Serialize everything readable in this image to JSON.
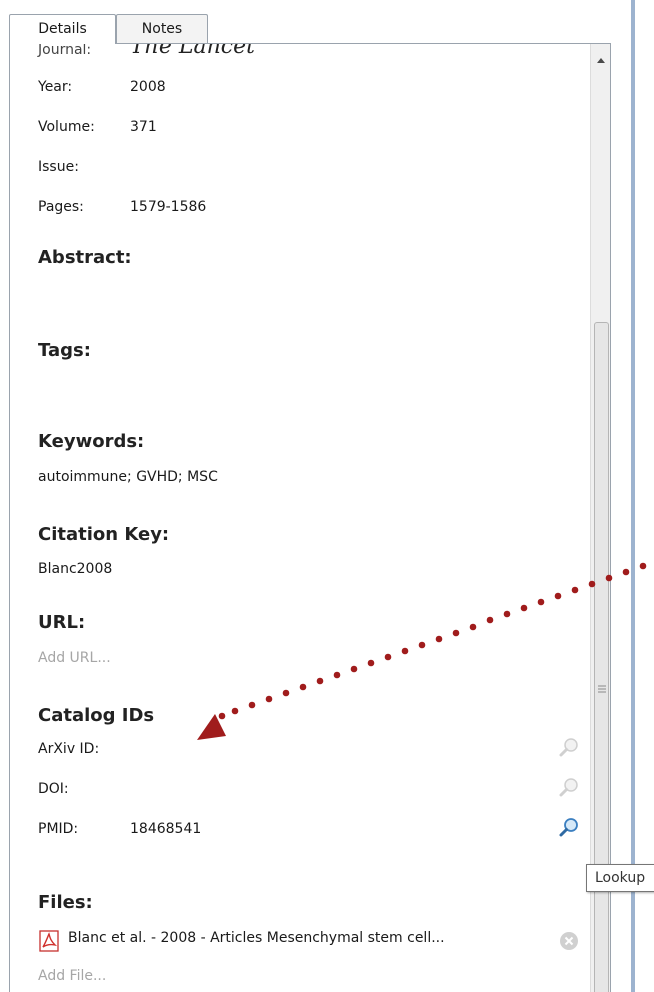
{
  "tabs": [
    {
      "label": "Details",
      "active": true
    },
    {
      "label": "Notes",
      "active": false
    }
  ],
  "fields": {
    "journal_label": "Journal:",
    "journal_value": "The Lancet",
    "year_label": "Year:",
    "year_value": "2008",
    "volume_label": "Volume:",
    "volume_value": "371",
    "issue_label": "Issue:",
    "issue_value": "",
    "pages_label": "Pages:",
    "pages_value": "1579-1586"
  },
  "sections": {
    "abstract": "Abstract:",
    "tags": "Tags:",
    "keywords": "Keywords:",
    "keywords_value": "autoimmune; GVHD; MSC",
    "citation_key": "Citation Key:",
    "citation_key_value": "Blanc2008",
    "url": "URL:",
    "url_placeholder": "Add URL...",
    "catalog_ids": "Catalog IDs",
    "files": "Files:",
    "add_file": "Add File..."
  },
  "catalog": [
    {
      "label": "ArXiv ID:",
      "value": "",
      "icon": "magnifier-icon",
      "active": false
    },
    {
      "label": "DOI:",
      "value": "",
      "icon": "magnifier-icon",
      "active": false
    },
    {
      "label": "PMID:",
      "value": "18468541",
      "icon": "magnifier-icon",
      "active": true
    }
  ],
  "files": [
    {
      "name": "Blanc et al. - 2008 - Articles Mesenchymal stem cell...",
      "icon": "pdf-icon"
    }
  ],
  "tooltip": "Lookup",
  "colors": {
    "arrow": "#a01c1c",
    "border": "#9aa3ad",
    "muted_text": "#a6a6a6",
    "window_edge": "#9db3cf"
  }
}
